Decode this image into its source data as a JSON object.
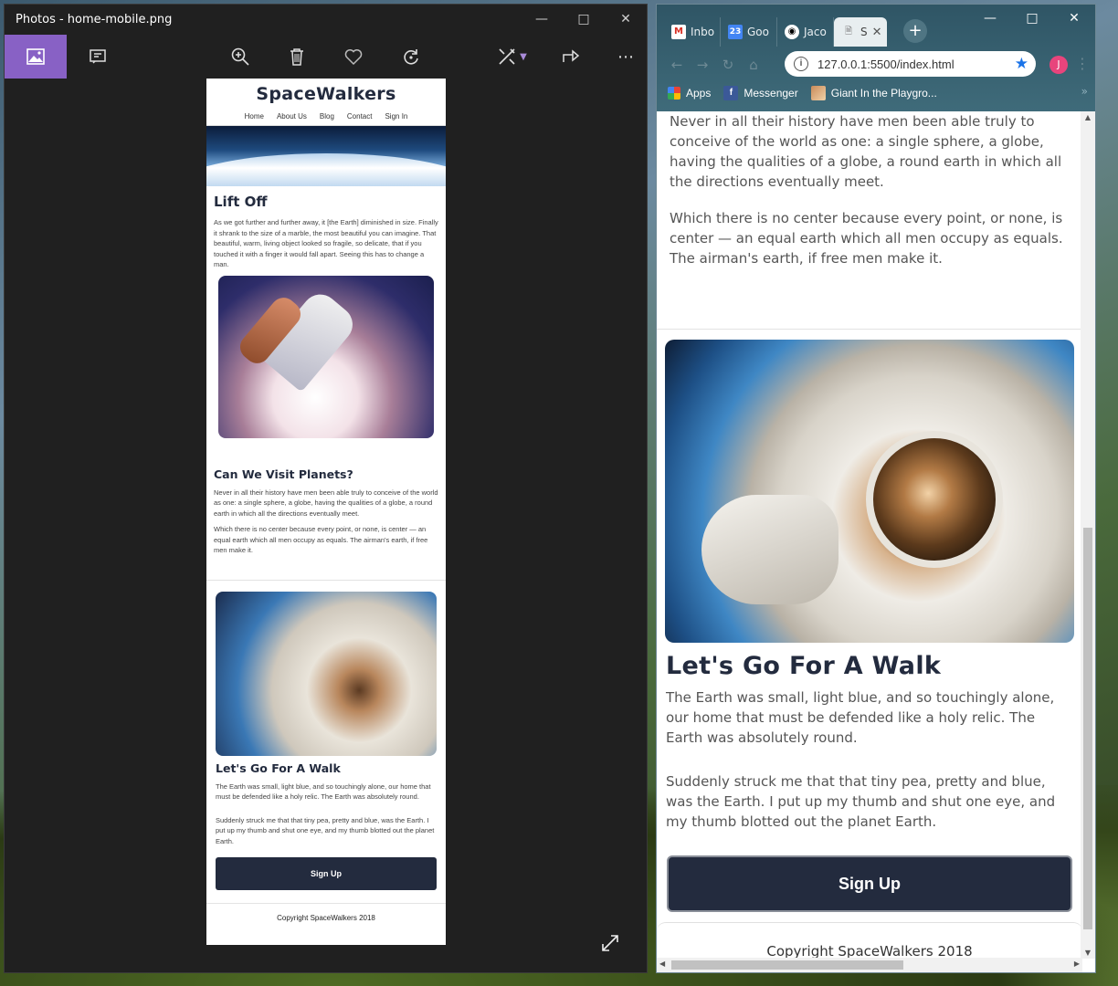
{
  "photos": {
    "title": "Photos - home-mobile.png",
    "preview": {
      "brand": "SpaceWalkers",
      "nav": [
        "Home",
        "About Us",
        "Blog",
        "Contact",
        "Sign In"
      ],
      "lift_off_title": "Lift Off",
      "lift_off_text": "As we got further and further away, it [the Earth] diminished in size. Finally it shrank to the size of a marble, the most beautiful you can imagine. That beautiful, warm, living object looked so fragile, so delicate, that if you touched it with a finger it would fall apart. Seeing this has to change a man.",
      "planets_title": "Can We Visit Planets?",
      "planets_p1": "Never in all their history have men been able truly to conceive of the world as one: a single sphere, a globe, having the qualities of a globe, a round earth in which all the directions eventually meet.",
      "planets_p2": "Which there is no center because every point, or none, is center — an equal earth which all men occupy as equals. The airman's earth, if free men make it.",
      "walk_title": "Let's Go For A Walk",
      "walk_p1": "The Earth was small, light blue, and so touchingly alone, our home that must be defended like a holy relic. The Earth was absolutely round.",
      "walk_p2": "Suddenly struck me that that tiny pea, pretty and blue, was the Earth. I put up my thumb and shut one eye, and my thumb blotted out the planet Earth.",
      "signup": "Sign Up",
      "footer": "Copyright SpaceWalkers 2018"
    }
  },
  "chrome": {
    "tabs": [
      {
        "label": "Inbo",
        "icon": "gmail-icon"
      },
      {
        "label": "Goo",
        "icon": "calendar-icon"
      },
      {
        "label": "Jaco",
        "icon": "github-icon"
      },
      {
        "label": "S",
        "icon": "page-icon"
      }
    ],
    "calendar_day": "23",
    "url": "127.0.0.1:5500/index.html",
    "avatar_letter": "J",
    "bookmarks": [
      {
        "label": "Apps",
        "icon": "apps-grid-icon"
      },
      {
        "label": "Messenger",
        "icon": "facebook-icon"
      },
      {
        "label": "Giant In the Playgro...",
        "icon": "bookmark-thumbnail-icon"
      }
    ],
    "content": {
      "para1": "Never in all their history have men been able truly to conceive of the world as one: a single sphere, a globe, having the qualities of a globe, a round earth in which all the directions eventually meet.",
      "para2": "Which there is no center because every point, or none, is center — an equal earth which all men occupy as equals. The airman's earth, if free men make it.",
      "walk_title": "Let's Go For A Walk",
      "walk_p1": "The Earth was small, light blue, and so touchingly alone, our home that must be defended like a holy relic. The Earth was absolutely round.",
      "walk_p2": "Suddenly struck me that that tiny pea, pretty and blue, was the Earth. I put up my thumb and shut one eye, and my thumb blotted out the planet Earth.",
      "signup": "Sign Up",
      "footer": "Copyright SpaceWalkers 2018"
    }
  },
  "colors": {
    "brand_navy": "#232b3e",
    "photos_accent": "#8861c5",
    "chrome_frame": "#2f5565"
  }
}
